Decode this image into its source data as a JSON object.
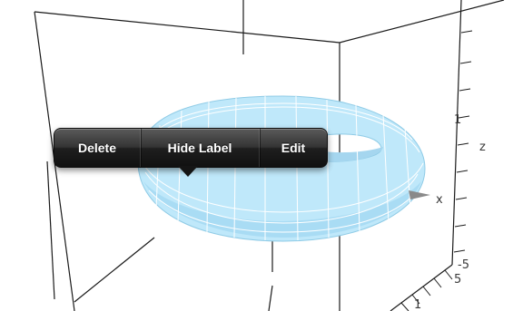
{
  "axes": {
    "x_label": "x",
    "z_label": "z",
    "tick_z_1": "1",
    "tick_z_neg5": "-5",
    "tick_y_5": "5",
    "tick_y_1": "1"
  },
  "surface": {
    "fill_color": "#bfe8fa",
    "stroke_color": "#ffffff"
  },
  "context_menu": {
    "items": [
      {
        "label": "Delete"
      },
      {
        "label": "Hide Label"
      },
      {
        "label": "Edit"
      }
    ]
  }
}
